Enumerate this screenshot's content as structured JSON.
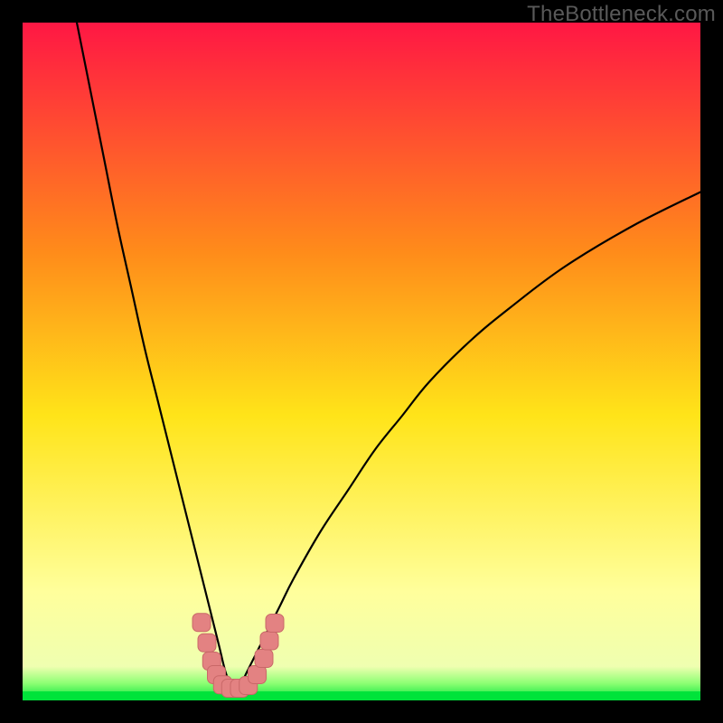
{
  "watermark": "TheBottleneck.com",
  "colors": {
    "frame": "#000000",
    "watermark": "#595959",
    "curve": "#000000",
    "marker_fill": "#E38282",
    "marker_stroke": "#C96868",
    "green_band": "#00E33A",
    "gradient_top": "#FF1744",
    "gradient_mid_upper": "#FF8C1A",
    "gradient_mid": "#FFE419",
    "gradient_mid_lower": "#FFFF9C",
    "gradient_bottom": "#00E33A"
  },
  "chart_data": {
    "type": "line",
    "title": "",
    "xlabel": "",
    "ylabel": "",
    "xlim": [
      0,
      100
    ],
    "ylim": [
      0,
      100
    ],
    "grid": false,
    "legend": false,
    "description": "Bottleneck percentage curve with a sharp minimum near x≈30; vertical gradient background from red (high bottleneck) through yellow to green (no bottleneck). Pink rounded markers overlay the curve trough.",
    "series": [
      {
        "name": "bottleneck-curve",
        "x": [
          8,
          10,
          12,
          14,
          16,
          18,
          20,
          22,
          24,
          26,
          27,
          28,
          29,
          30,
          31,
          32,
          33,
          34,
          36,
          38,
          40,
          44,
          48,
          52,
          56,
          60,
          66,
          72,
          80,
          90,
          100
        ],
        "y": [
          100,
          90,
          80,
          70,
          61,
          52,
          44,
          36,
          28,
          20,
          16,
          12,
          8,
          4,
          2,
          2,
          4,
          6,
          10,
          14,
          18,
          25,
          31,
          37,
          42,
          47,
          53,
          58,
          64,
          70,
          75
        ]
      }
    ],
    "markers": [
      {
        "x": 26.4,
        "y": 11.5
      },
      {
        "x": 27.2,
        "y": 8.5
      },
      {
        "x": 27.9,
        "y": 5.8
      },
      {
        "x": 28.6,
        "y": 3.8
      },
      {
        "x": 29.5,
        "y": 2.3
      },
      {
        "x": 30.7,
        "y": 1.8
      },
      {
        "x": 32.0,
        "y": 1.8
      },
      {
        "x": 33.3,
        "y": 2.2
      },
      {
        "x": 34.6,
        "y": 3.8
      },
      {
        "x": 35.6,
        "y": 6.2
      },
      {
        "x": 36.4,
        "y": 8.8
      },
      {
        "x": 37.2,
        "y": 11.4
      }
    ],
    "gradient_stops": [
      {
        "offset": 0.0,
        "color": "#FF1744"
      },
      {
        "offset": 0.34,
        "color": "#FF8C1A"
      },
      {
        "offset": 0.58,
        "color": "#FFE419"
      },
      {
        "offset": 0.84,
        "color": "#FFFF9C"
      },
      {
        "offset": 0.95,
        "color": "#EFFFB0"
      },
      {
        "offset": 0.975,
        "color": "#8CFF73"
      },
      {
        "offset": 1.0,
        "color": "#00E33A"
      }
    ]
  }
}
